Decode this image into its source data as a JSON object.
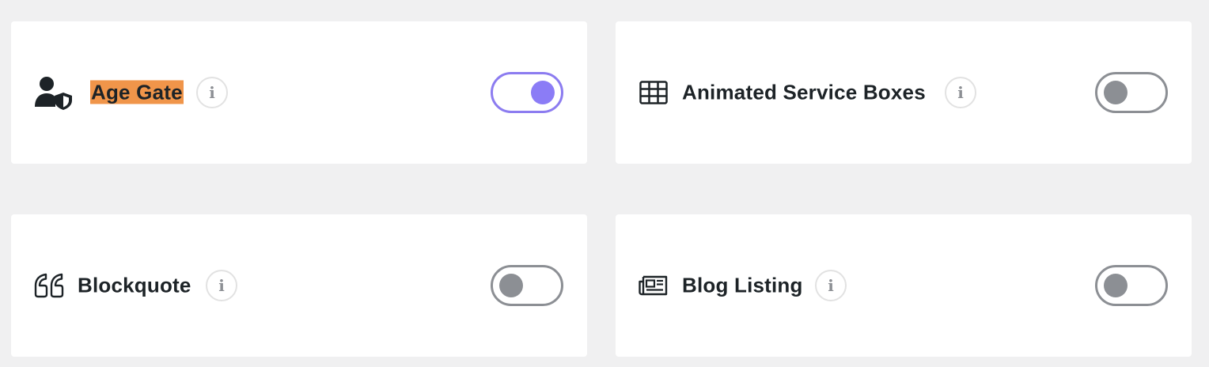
{
  "modules": [
    {
      "label": "Age Gate",
      "icon": "user-shield-icon",
      "info_glyph": "i",
      "enabled": true,
      "highlighted": true
    },
    {
      "label": "Animated Service Boxes",
      "icon": "grid-table-icon",
      "info_glyph": "i",
      "enabled": false,
      "highlighted": false
    },
    {
      "label": "Blockquote",
      "icon": "quote-icon",
      "info_glyph": "i",
      "enabled": false,
      "highlighted": false
    },
    {
      "label": "Blog Listing",
      "icon": "newspaper-icon",
      "info_glyph": "i",
      "enabled": false,
      "highlighted": false
    }
  ],
  "colors": {
    "background": "#f0f0f1",
    "card": "#ffffff",
    "highlight": "#f0954a",
    "toggle_on": "#8b7cf6",
    "toggle_off": "#8c8f94",
    "text": "#1d2327"
  }
}
